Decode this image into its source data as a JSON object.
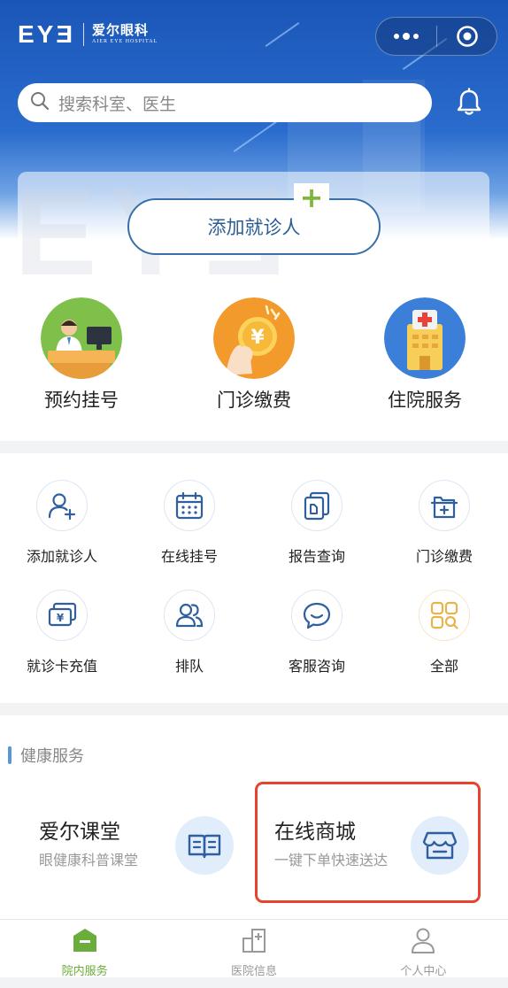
{
  "header": {
    "logo_mark": "EYƎ",
    "logo_cn": "爱尔眼科",
    "logo_en": "AIER EYE HOSPITAL",
    "capsule_more_icon": "more-dots-icon",
    "capsule_close_icon": "target-close-icon"
  },
  "search": {
    "placeholder": "搜索科室、医生",
    "notification_icon": "bell-icon"
  },
  "add_patient": {
    "watermark": "EYƎ",
    "label": "添加就诊人",
    "plus": "+"
  },
  "primary_services": [
    {
      "label": "预约挂号",
      "icon": "doctor-desk-icon"
    },
    {
      "label": "门诊缴费",
      "icon": "yuan-coin-icon"
    },
    {
      "label": "住院服务",
      "icon": "hospital-building-icon"
    }
  ],
  "quick_grid": [
    {
      "label": "添加就诊人",
      "icon": "add-user-icon"
    },
    {
      "label": "在线挂号",
      "icon": "calendar-icon"
    },
    {
      "label": "报告查询",
      "icon": "report-icon"
    },
    {
      "label": "门诊缴费",
      "icon": "payment-box-icon"
    },
    {
      "label": "就诊卡充值",
      "icon": "card-recharge-icon"
    },
    {
      "label": "排队",
      "icon": "queue-people-icon"
    },
    {
      "label": "客服咨询",
      "icon": "chat-bubble-icon"
    },
    {
      "label": "全部",
      "icon": "all-apps-icon"
    }
  ],
  "health_services": {
    "title": "健康服务",
    "cards": [
      {
        "title": "爱尔课堂",
        "subtitle": "眼健康科普课堂",
        "icon": "open-book-icon"
      },
      {
        "title": "在线商城",
        "subtitle": "一键下单快速送达",
        "icon": "store-icon"
      }
    ]
  },
  "tabbar": [
    {
      "label": "院内服务",
      "icon": "hospital-service-icon",
      "active": true
    },
    {
      "label": "医院信息",
      "icon": "hospital-info-icon",
      "active": false
    },
    {
      "label": "个人中心",
      "icon": "person-icon",
      "active": false
    }
  ],
  "colors": {
    "header_blue": "#1a56b8",
    "accent_green": "#6aad3a",
    "highlight_red": "#e8432f",
    "icon_blue": "#2f5f9e"
  }
}
